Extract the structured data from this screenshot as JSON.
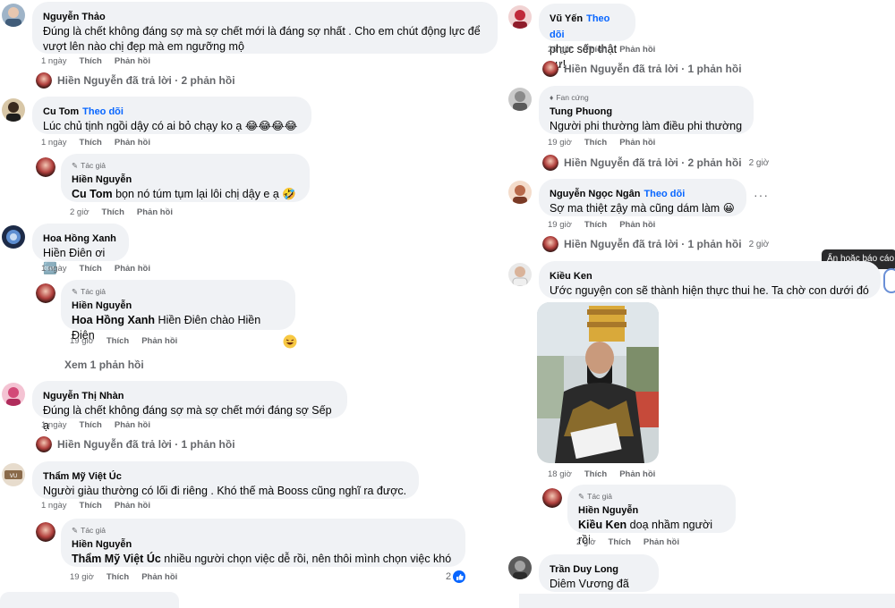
{
  "left": {
    "c1": {
      "name": "Nguyễn Thảo",
      "text1": "Đúng là chết không đáng sợ mà sợ chết mới là đáng sợ nhất . Cho em chút động lực để",
      "text2": "vượt lên nào chị đẹp mà em ngưỡng mộ",
      "time": "1 ngày",
      "like": "Thích",
      "reply": "Phản hồi",
      "replied": "Hiền Nguyễn đã trả lời · 2 phản hồi"
    },
    "c2": {
      "name": "Cu Tom",
      "follow": "Theo dõi",
      "text": "Lúc chủ tịnh ngồi dậy có ai bỏ chạy ko ạ 😂😂😂😂",
      "time": "1 ngày",
      "like": "Thích",
      "reply": "Phản hồi"
    },
    "r2": {
      "badge": "Tác giả",
      "name": "Hiền Nguyễn",
      "mention": "Cu Tom",
      "text": " bọn nó túm tụm lại lôi chị dậy e ạ 🤣",
      "time": "2 giờ",
      "like": "Thích",
      "reply": "Phản hồi"
    },
    "c3": {
      "name": "Hoa Hồng Xanh",
      "text": "Hiền Điên ơi 🆒",
      "time": "1 ngày",
      "like": "Thích",
      "reply": "Phản hồi"
    },
    "r3": {
      "badge": "Tác giả",
      "name": "Hiền Nguyễn",
      "mention": "Hoa Hồng Xanh",
      "text": " Hiền Điên chào Hiền Điên",
      "time": "19 giờ",
      "like": "Thích",
      "reply": "Phản hồi",
      "see_more": "Xem 1 phản hồi"
    },
    "c4": {
      "name": "Nguyễn Thị Nhàn",
      "text": "Đúng là chết không đáng sợ mà sợ chết mới đáng sợ Sếp ạ",
      "time": "1 ngày",
      "like": "Thích",
      "reply": "Phản hồi",
      "replied": "Hiền Nguyễn đã trả lời · 1 phản hồi"
    },
    "c5": {
      "name": "Thẩm Mỹ Việt Úc",
      "text": "Người giàu thường có lối đi riêng . Khó thế mà Booss cũng nghĩ ra được.",
      "time": "1 ngày",
      "like": "Thích",
      "reply": "Phản hồi"
    },
    "r5": {
      "badge": "Tác giả",
      "name": "Hiền Nguyễn",
      "mention": "Thẩm Mỹ Việt Úc",
      "text": " nhiều người chọn việc dễ rồi, nên thôi mình chọn việc khó",
      "time": "19 giờ",
      "like": "Thích",
      "reply": "Phản hồi",
      "likes": "2"
    }
  },
  "right": {
    "c1": {
      "name": "Vũ Yến",
      "follow": "Theo dõi",
      "text": "phục sếp thật sự!",
      "time": "20 giờ",
      "like": "Thích",
      "reply": "Phản hồi",
      "replied": "Hiền Nguyễn đã trả lời · 1 phản hồi"
    },
    "c2": {
      "badge": "Fan cứng",
      "name": "Tung Phuong",
      "text": "Người phi thường làm điều phi thường",
      "time": "19 giờ",
      "like": "Thích",
      "reply": "Phản hồi",
      "replied": "Hiền Nguyễn đã trả lời · 2 phản hồi",
      "ago": "2 giờ"
    },
    "c3": {
      "name": "Nguyễn Ngọc Ngân",
      "follow": "Theo dõi",
      "text": "Sợ ma thiệt zậy mà cũng dám làm 😀",
      "time": "19 giờ",
      "like": "Thích",
      "reply": "Phản hồi",
      "more": "···",
      "replied": "Hiền Nguyễn đã trả lời · 1 phản hồi",
      "ago": "2 giờ"
    },
    "c4": {
      "name": "Kiều Ken",
      "text": "Ước nguyện con sẽ thành hiện thực thui he. Ta chờ con dưới đó .",
      "time": "18 giờ",
      "like": "Thích",
      "reply": "Phản hồi"
    },
    "r4": {
      "badge": "Tác giả",
      "name": "Hiền Nguyễn",
      "mention": "Kiều Ken",
      "text": " doạ nhầm người rồi",
      "time": "2 giờ",
      "like": "Thích",
      "reply": "Phản hồi"
    },
    "c5": {
      "name": "Trần Duy Long",
      "text": "Diêm Vương đã xem"
    }
  },
  "tooltip": "Ẩn hoặc báo cáo",
  "colors": {
    "bubble": "#f0f2f5",
    "link": "#0866ff",
    "meta": "#65676b"
  }
}
